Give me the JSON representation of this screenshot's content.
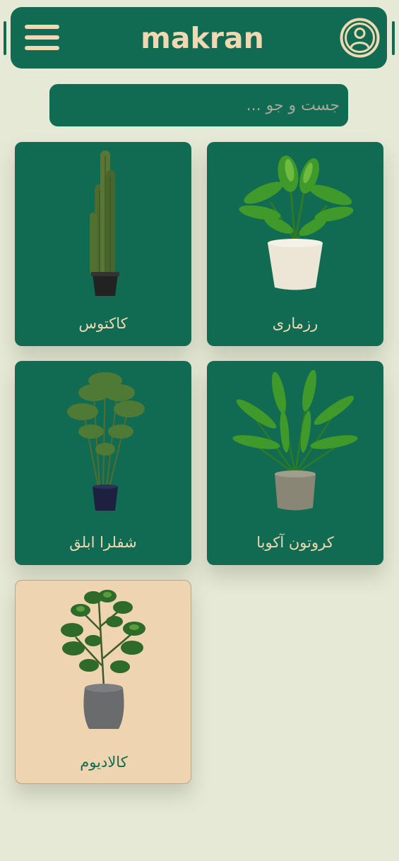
{
  "header": {
    "brand": "makran",
    "menu_icon": "hamburger-menu-icon",
    "profile_icon": "user-circle-icon"
  },
  "search": {
    "placeholder": "جست و جو ..."
  },
  "colors": {
    "background": "#e6e9d6",
    "primary": "#116b52",
    "accent": "#efd8b2",
    "selected_card": "#efd4b0"
  },
  "products": [
    {
      "name": "رزماری",
      "image": "potted-leafy-plant-white-pot"
    },
    {
      "name": "کاکتوس",
      "image": "cactus-black-pot"
    },
    {
      "name": "کروتون آکوبا",
      "image": "potted-leafy-plant-stone-pot"
    },
    {
      "name": "شفلرا ابلق",
      "image": "bamboo-palm-navy-pot"
    },
    {
      "name": "کالادیوم",
      "image": "rubber-plant-grey-pot"
    }
  ]
}
